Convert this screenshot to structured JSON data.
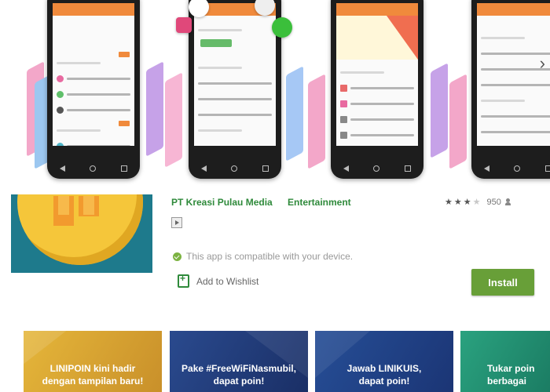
{
  "carousel": {
    "next_arrow": "›",
    "icon_next": "chevron-right-icon"
  },
  "app": {
    "developer": "PT Kreasi Pulau Media",
    "category": "Entertainment",
    "rating_count": "950",
    "rating_stars": 3,
    "compatibility": "This app is compatible with your device.",
    "wishlist_label": "Add to Wishlist",
    "install_label": "Install"
  },
  "banners": [
    {
      "line1": "LINIPOIN kini hadir",
      "line2": "dengan tampilan baru!"
    },
    {
      "line1": "Pake #FreeWiFiNasmubil,",
      "line2": "dapat poin!"
    },
    {
      "line1": "Jawab LINIKUIS,",
      "line2": "dapat poin!"
    },
    {
      "line1": "Tukar poin",
      "line2": "berbagai"
    }
  ],
  "colors": {
    "accent_green": "#2f8a3b",
    "install_button": "#689f38",
    "app_bar_orange": "#f08a3c"
  }
}
